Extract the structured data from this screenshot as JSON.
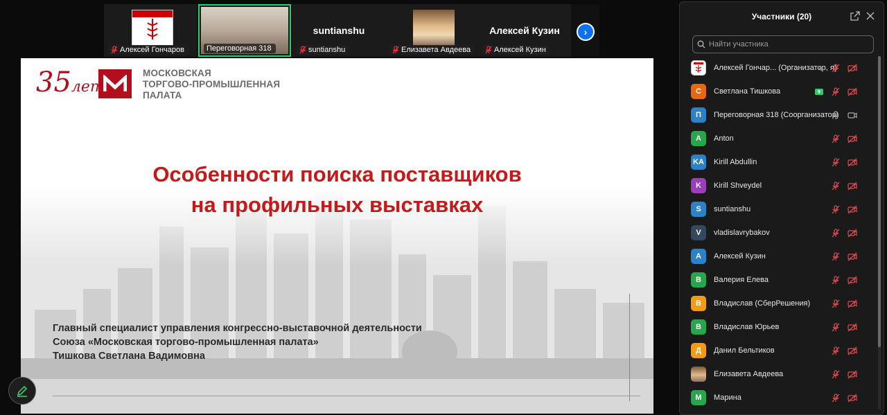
{
  "thumbnails": [
    {
      "name": "Алексей Гончаров",
      "kind": "logo"
    },
    {
      "name": "Переговорная 318",
      "kind": "room",
      "active": true
    },
    {
      "name": "suntianshu",
      "kind": "text",
      "big": "suntianshu"
    },
    {
      "name": "Елизавета Авдеева",
      "kind": "photo"
    },
    {
      "name": "Алексей Кузин",
      "kind": "text",
      "big": "Алексей Кузин"
    }
  ],
  "slide": {
    "logo_text": "35",
    "logo_suffix": "лет",
    "org_line1": "МОСКОВСКАЯ",
    "org_line2": "ТОРГОВО-ПРОМЫШЛЕННАЯ",
    "org_line3": "ПАЛАТА",
    "title_line1": "Особенности поиска поставщиков",
    "title_line2": "на профильных выставках",
    "speaker_line1": "Главный специалист управления конгрессно-выставочной деятельности",
    "speaker_line2": "Союза «Московская торгово-промышленная палата»",
    "speaker_line3": "Тишкова Светлана Вадимовна",
    "accent": "#c41a1a"
  },
  "panel": {
    "title": "Участники (20)",
    "search_placeholder": "Найти участника",
    "participants": [
      {
        "initial": "",
        "name": "Алексей Гончар...  (Организатор, я)",
        "color": "#ffffff",
        "avatar": "logo",
        "mic": "muted",
        "video": "off",
        "extra": "dot"
      },
      {
        "initial": "С",
        "name": "Светлана Тишкова",
        "color": "#e8680f",
        "mic": "muted",
        "video": "off",
        "extra": "share"
      },
      {
        "initial": "П",
        "name": "Переговорная 318 (Соорганизатор)",
        "color": "#2b82c9",
        "mic": "on",
        "video": "on"
      },
      {
        "initial": "A",
        "name": "Anton",
        "color": "#27a64b",
        "mic": "muted",
        "video": "off"
      },
      {
        "initial": "KA",
        "name": "Kirill Abdullin",
        "color": "#2b82c9",
        "mic": "muted",
        "video": "off"
      },
      {
        "initial": "K",
        "name": "Kirill Shveydel",
        "color": "#9b3fb8",
        "mic": "muted",
        "video": "off"
      },
      {
        "initial": "S",
        "name": "suntianshu",
        "color": "#2b82c9",
        "mic": "muted",
        "video": "off"
      },
      {
        "initial": "V",
        "name": "vladislavrybakov",
        "color": "#34495e",
        "mic": "muted",
        "video": "off"
      },
      {
        "initial": "А",
        "name": "Алексей Кузин",
        "color": "#2b82c9",
        "mic": "muted",
        "video": "off"
      },
      {
        "initial": "В",
        "name": "Валерия Елева",
        "color": "#27a64b",
        "mic": "muted",
        "video": "off"
      },
      {
        "initial": "В",
        "name": "Владислав (СберРешения)",
        "color": "#f39c12",
        "mic": "muted",
        "video": "off"
      },
      {
        "initial": "В",
        "name": "Владислав Юрьев",
        "color": "#27a64b",
        "mic": "muted",
        "video": "off"
      },
      {
        "initial": "Д",
        "name": "Данил Бельтиков",
        "color": "#f39c12",
        "mic": "muted",
        "video": "off"
      },
      {
        "initial": "",
        "name": "Елизавета Авдеева",
        "color": "#c09060",
        "avatar": "photo",
        "mic": "muted",
        "video": "off"
      },
      {
        "initial": "М",
        "name": "Марина",
        "color": "#27a64b",
        "mic": "muted",
        "video": "off"
      }
    ]
  }
}
